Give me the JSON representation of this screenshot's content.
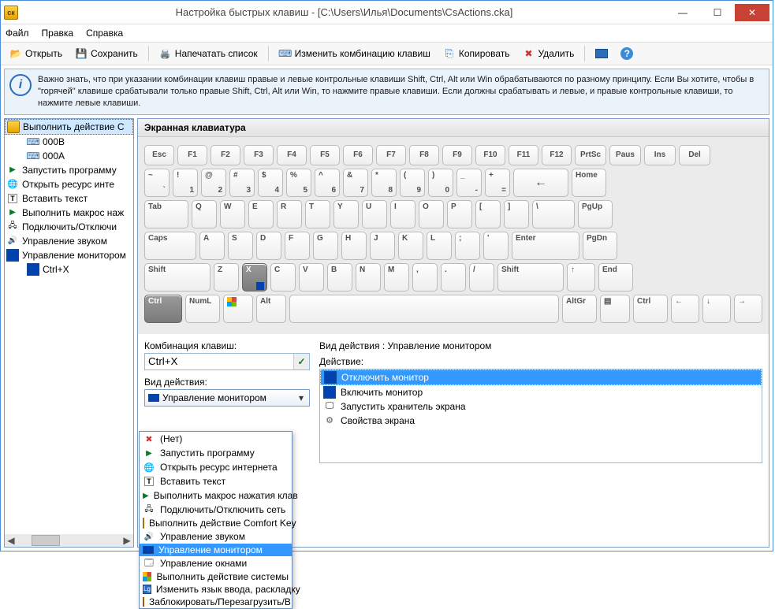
{
  "title": "Настройка быстрых клавиш - [C:\\Users\\Илья\\Documents\\CsActions.cka]",
  "menu": {
    "file": "Файл",
    "edit": "Правка",
    "help": "Справка"
  },
  "toolbar": {
    "open": "Открыть",
    "save": "Сохранить",
    "print": "Напечатать список",
    "change": "Изменить комбинацию клавиш",
    "copy": "Копировать",
    "delete": "Удалить"
  },
  "info": "Важно знать, что при указании комбинации клавиш правые и левые контрольные клавиши Shift, Ctrl, Alt или Win обрабатываются по разному принципу. Если Вы хотите, чтобы в \"горячей\" клавише срабатывали только правые Shift, Ctrl, Alt или Win, то нажмите правые клавиши. Если должны срабатывать и левые, и правые контрольные клавиши, то нажмите левые клавиши.",
  "tree": [
    {
      "label": "Выполнить действие C",
      "icon": "ic-app",
      "sel": true
    },
    {
      "label": "000B",
      "icon": "ic-kbd",
      "indent": 1
    },
    {
      "label": "000A",
      "icon": "ic-kbd",
      "indent": 1
    },
    {
      "label": "Запустить программу",
      "icon": "ic-play"
    },
    {
      "label": "Открыть ресурс инте",
      "icon": "ic-globe"
    },
    {
      "label": "Вставить текст",
      "icon": "ic-txt"
    },
    {
      "label": "Выполнить макрос наж",
      "icon": "ic-macro"
    },
    {
      "label": "Подключить/Отключи",
      "icon": "ic-net"
    },
    {
      "label": "Управление звуком",
      "icon": "ic-sound"
    },
    {
      "label": "Управление монитором",
      "icon": "ic-mon"
    },
    {
      "label": "Ctrl+X",
      "icon": "ic-mon",
      "indent": 1
    }
  ],
  "kbd_title": "Экранная клавиатура",
  "rows": {
    "r1": [
      "Esc",
      "F1",
      "F2",
      "F3",
      "F4",
      "F5",
      "F6",
      "F7",
      "F8",
      "F9",
      "F10",
      "F11",
      "F12",
      "PrtSc",
      "Paus",
      "Ins",
      "Del"
    ],
    "r2": [
      [
        "`",
        "~"
      ],
      [
        "1",
        "!"
      ],
      [
        "2",
        "@"
      ],
      [
        "3",
        "#"
      ],
      [
        "4",
        "$"
      ],
      [
        "5",
        "%"
      ],
      [
        "6",
        "^"
      ],
      [
        "7",
        "&"
      ],
      [
        "8",
        "*"
      ],
      [
        "9",
        "("
      ],
      [
        "0",
        ")"
      ],
      [
        "-",
        "_"
      ],
      [
        "=",
        "+"
      ],
      "←",
      "Home"
    ],
    "r3": [
      "Tab",
      "Q",
      "W",
      "E",
      "R",
      "T",
      "Y",
      "U",
      "I",
      "O",
      "P",
      "[",
      "]",
      "\\",
      "PgUp"
    ],
    "r4": [
      "Caps",
      "A",
      "S",
      "D",
      "F",
      "G",
      "H",
      "J",
      "K",
      "L",
      ";",
      "'",
      "Enter",
      "PgDn"
    ],
    "r5": [
      "Shift",
      "Z",
      "X",
      "C",
      "V",
      "B",
      "N",
      "M",
      ",",
      ".",
      "/",
      "Shift",
      "↑",
      "End"
    ],
    "r6": [
      "Ctrl",
      "NumL",
      "",
      "Alt",
      "",
      "AltGr",
      "",
      "Ctrl",
      "←",
      "↓",
      "→"
    ]
  },
  "lower": {
    "combo_label": "Комбинация клавиш:",
    "combo_value": "Ctrl+X",
    "type_label": "Вид действия:",
    "type_value": "Управление монитором",
    "rtitle": "Вид действия : Управление монитором",
    "rlist_label": "Действие:",
    "actions": [
      {
        "label": "Отключить монитор",
        "icon": "ic-mon",
        "sel": true
      },
      {
        "label": "Включить монитор",
        "icon": "ic-mon"
      },
      {
        "label": "Запустить хранитель экрана",
        "icon": "ic-screen"
      },
      {
        "label": "Свойства экрана",
        "icon": "ic-gear"
      }
    ]
  },
  "popup": [
    {
      "label": "(Нет)",
      "icon": "ic-red"
    },
    {
      "label": "Запустить программу",
      "icon": "ic-play"
    },
    {
      "label": "Открыть ресурс интернета",
      "icon": "ic-globe"
    },
    {
      "label": "Вставить текст",
      "icon": "ic-txt"
    },
    {
      "label": "Выполнить макрос нажатия клав",
      "icon": "ic-macro"
    },
    {
      "label": "Подключить/Отключить сеть",
      "icon": "ic-net"
    },
    {
      "label": "Выполнить действие Comfort Key",
      "icon": "ic-app"
    },
    {
      "label": "Управление звуком",
      "icon": "ic-sound"
    },
    {
      "label": "Управление монитором",
      "icon": "ic-mon",
      "sel": true
    },
    {
      "label": "Управление окнами",
      "icon": "ic-windows"
    },
    {
      "label": "Выполнить действие системы",
      "icon": "ic-winlogo"
    },
    {
      "label": "Изменить язык ввода, раскладку",
      "icon": "ic-lang"
    },
    {
      "label": "Заблокировать/Перезагрузить/В",
      "icon": "ic-lock"
    }
  ]
}
